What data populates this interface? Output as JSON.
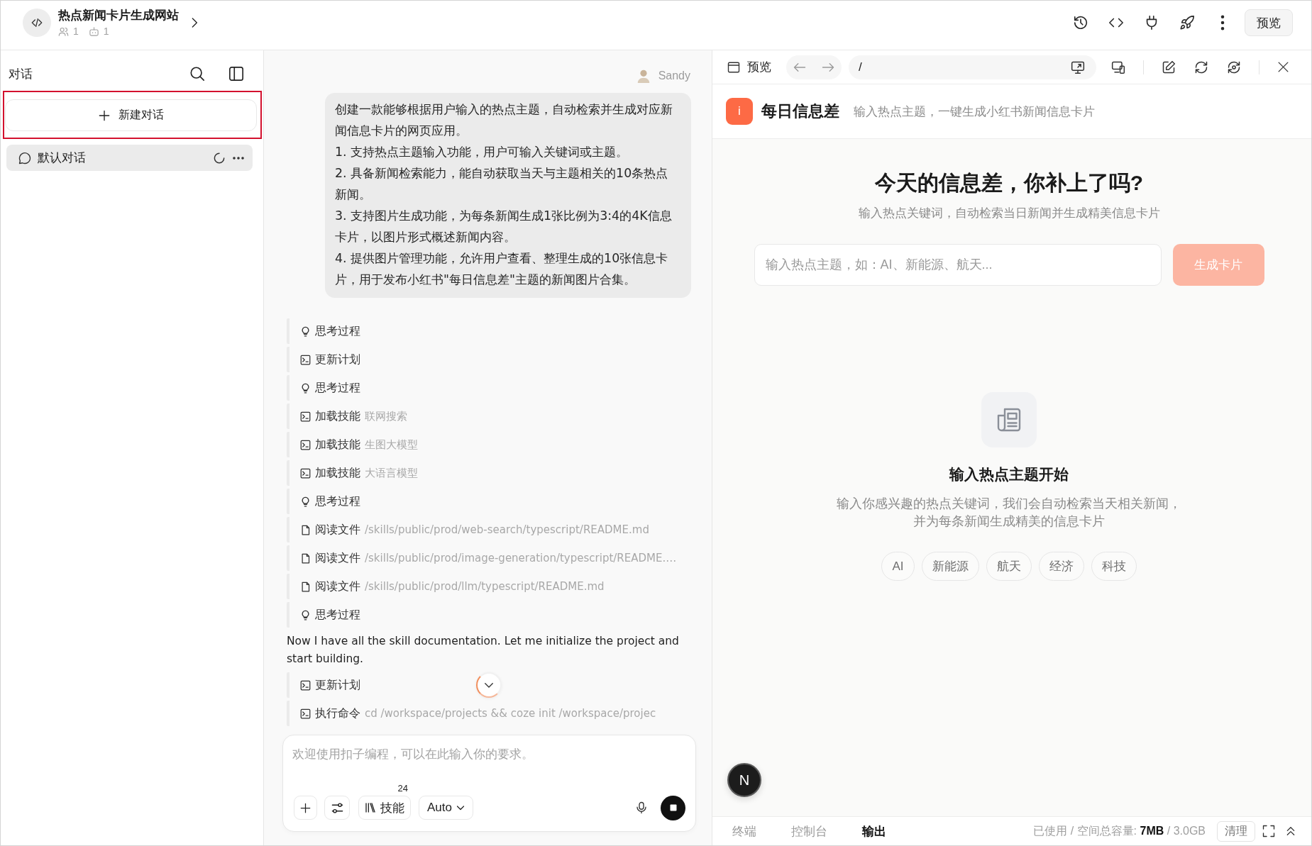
{
  "project": {
    "title": "热点新闻卡片生成网站",
    "members": "1",
    "bots": "1"
  },
  "top_bar": {
    "preview_button": "预览"
  },
  "sidebar": {
    "title": "对话",
    "new_chat": {
      "label": "新建对话",
      "highlighted": true
    },
    "conversations": [
      {
        "title": "默认对话",
        "selected": true,
        "loading": true
      }
    ]
  },
  "chat": {
    "sender": "Sandy",
    "message": [
      "创建一款能够根据用户输入的热点主题，自动检索并生成对应新闻信息卡片的网页应用。",
      "1. 支持热点主题输入功能，用户可输入关键词或主题。",
      "2. 具备新闻检索能力，能自动获取当天与主题相关的10条热点新闻。",
      "3. 支持图片生成功能，为每条新闻生成1张比例为3:4的4K信息卡片，以图片形式概述新闻内容。",
      "4. 提供图片管理功能，允许用户查看、整理生成的10张信息卡片，用于发布小红书\"每日信息差\"主题的新闻图片合集。"
    ],
    "timeline": [
      {
        "kind": "thinking",
        "label": "思考过程"
      },
      {
        "kind": "plan",
        "label": "更新计划"
      },
      {
        "kind": "thinking",
        "label": "思考过程"
      },
      {
        "kind": "skill",
        "label": "加载技能",
        "detail": "联网搜索"
      },
      {
        "kind": "skill",
        "label": "加载技能",
        "detail": "生图大模型"
      },
      {
        "kind": "skill",
        "label": "加载技能",
        "detail": "大语言模型"
      },
      {
        "kind": "thinking",
        "label": "思考过程"
      },
      {
        "kind": "file",
        "label": "阅读文件",
        "detail": "/skills/public/prod/web-search/typescript/README.md"
      },
      {
        "kind": "file",
        "label": "阅读文件",
        "detail": "/skills/public/prod/image-generation/typescript/README.…"
      },
      {
        "kind": "file",
        "label": "阅读文件",
        "detail": "/skills/public/prod/llm/typescript/README.md"
      },
      {
        "kind": "thinking",
        "label": "思考过程"
      },
      {
        "kind": "text",
        "text": "Now I have all the skill documentation. Let me initialize the project and start building."
      },
      {
        "kind": "plan",
        "label": "更新计划"
      },
      {
        "kind": "command",
        "label": "执行命令",
        "detail": "cd /workspace/projects && coze init /workspace/projec"
      }
    ],
    "composer": {
      "placeholder": "欢迎使用扣子编程，可以在此输入你的要求。",
      "skills_button": "技能",
      "skills_count": "24",
      "model": "Auto",
      "running": true
    }
  },
  "preview": {
    "title": "预览",
    "url": "/",
    "app": {
      "logo": "i",
      "name": "每日信息差",
      "tagline": "输入热点主题，一键生成小红书新闻信息卡片"
    },
    "hero": {
      "title": "今天的信息差，你补上了吗?",
      "subtitle": "输入热点关键词，自动检索当日新闻并生成精美信息卡片"
    },
    "search": {
      "placeholder": "输入热点主题，如：AI、新能源、航天..."
    },
    "generate_button": {
      "label": "生成卡片",
      "disabled": true
    },
    "empty_state": {
      "title": "输入热点主题开始",
      "description": "输入你感兴趣的热点关键词，我们会自动检索当天相关新闻，并为每条新闻生成精美的信息卡片"
    },
    "topics": [
      "AI",
      "新能源",
      "航天",
      "经济",
      "科技"
    ],
    "dev_badge": "N"
  },
  "bottom_panel": {
    "tabs": [
      {
        "label": "终端",
        "selected": false
      },
      {
        "label": "控制台",
        "selected": false
      },
      {
        "label": "输出",
        "selected": true
      }
    ],
    "storage": "已使用 / 空间总容量: **7MB** / 3.0GB",
    "clear_button": "清理"
  }
}
